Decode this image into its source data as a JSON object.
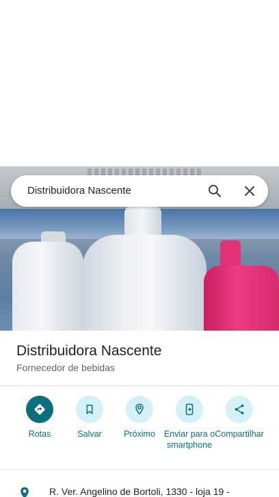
{
  "search": {
    "query": "Distribuidora Nascente"
  },
  "place": {
    "title": "Distribuidora Nascente",
    "category": "Fornecedor de bebidas"
  },
  "actions": [
    {
      "label": "Rotas",
      "icon": "directions-icon"
    },
    {
      "label": "Salvar",
      "icon": "bookmark-icon"
    },
    {
      "label": "Próximo",
      "icon": "nearby-icon"
    },
    {
      "label": "Enviar para o smartphone",
      "icon": "send-to-phone-icon"
    },
    {
      "label": "Compartilhar",
      "icon": "share-icon"
    }
  ],
  "address": {
    "text": "R. Ver. Angelino de Bortoli, 1330 - loja 19 -"
  },
  "colors": {
    "accent": "#0b6f7d",
    "action_bg": "#d4f1f7"
  }
}
